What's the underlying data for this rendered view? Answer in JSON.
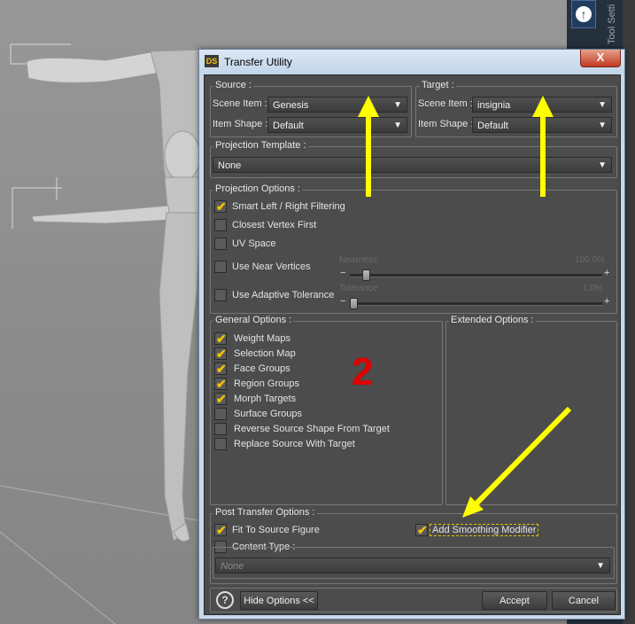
{
  "right_panel": {
    "tool_tab_label": "Tool Setti",
    "up_icon": "arrow-up-circle-icon"
  },
  "dialog": {
    "title": "Transfer Utility",
    "logo_text": "DS",
    "close_label": "X",
    "source": {
      "label": "Source :",
      "scene_item_label": "Scene Item :",
      "scene_item_value": "Genesis",
      "item_shape_label": "Item Shape :",
      "item_shape_value": "Default"
    },
    "target": {
      "label": "Target :",
      "scene_item_label": "Scene Item :",
      "scene_item_value": "insignia",
      "item_shape_label": "Item Shape :",
      "item_shape_value": "Default"
    },
    "projection_template": {
      "label": "Projection Template :",
      "value": "None"
    },
    "projection_options": {
      "label": "Projection Options :",
      "items": [
        {
          "label": "Smart Left / Right Filtering",
          "checked": true
        },
        {
          "label": "Closest Vertex First",
          "checked": false
        },
        {
          "label": "UV Space",
          "checked": false
        },
        {
          "label": "Use Near Vertices",
          "checked": false
        },
        {
          "label": "Use Adaptive Tolerance",
          "checked": false
        }
      ],
      "nearness": {
        "label": "Nearness",
        "value": "100.0%",
        "level": 0.05
      },
      "tolerance": {
        "label": "Tolerance",
        "value": "1.0%",
        "level": 0.0
      }
    },
    "general_options": {
      "label": "General Options :",
      "items": [
        {
          "label": "Weight Maps",
          "checked": true
        },
        {
          "label": "Selection Map",
          "checked": true
        },
        {
          "label": "Face Groups",
          "checked": true
        },
        {
          "label": "Region Groups",
          "checked": true
        },
        {
          "label": "Morph Targets",
          "checked": true
        },
        {
          "label": "Surface Groups",
          "checked": false
        },
        {
          "label": "Reverse Source Shape From Target",
          "checked": false
        },
        {
          "label": "Replace Source With Target",
          "checked": false
        }
      ]
    },
    "extended_options": {
      "label": "Extended Options :"
    },
    "post_transfer": {
      "label": "Post Transfer Options :",
      "fit_to_source": {
        "label": "Fit To Source Figure",
        "checked": true
      },
      "add_smoothing": {
        "label": "Add Smoothing Modifier",
        "checked": true
      },
      "content_type": {
        "label": "Content Type :",
        "checked": false,
        "value": "None"
      }
    },
    "footer": {
      "help_label": "?",
      "hide_options_label": "Hide Options <<",
      "accept_label": "Accept",
      "cancel_label": "Cancel"
    }
  },
  "annotation": {
    "number": "2",
    "color": "#e00000",
    "arrow_color": "#ffff00"
  }
}
